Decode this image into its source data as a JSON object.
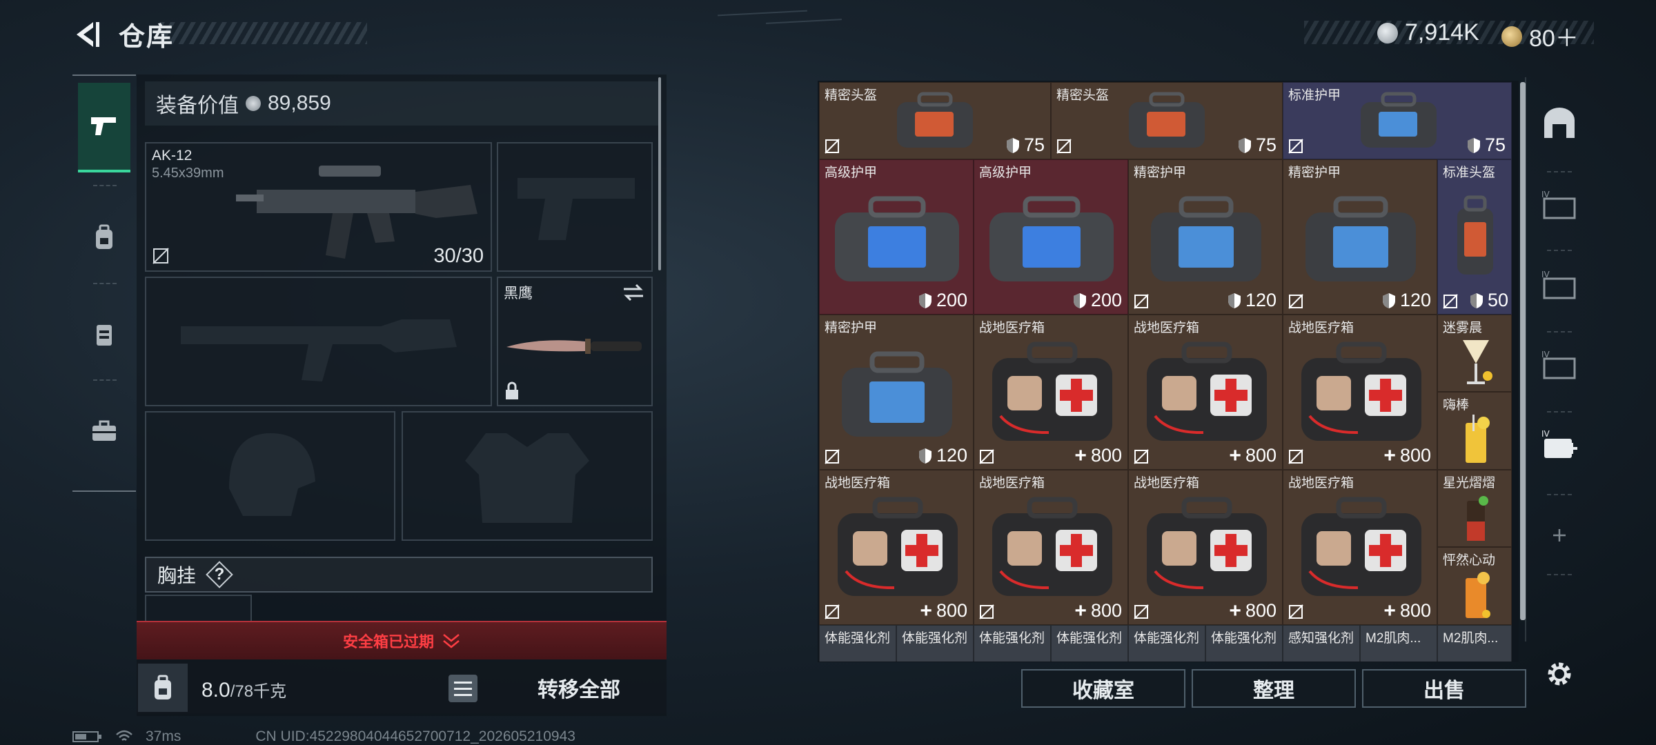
{
  "header": {
    "title": "仓库"
  },
  "currency": {
    "coins": "7,914K",
    "premium": "80＋"
  },
  "equipment": {
    "value_label": "装备价值",
    "value": "89,859",
    "weapon_primary": {
      "name": "AK-12",
      "caliber": "5.45x39mm",
      "ammo": "30/30"
    },
    "knife": {
      "name": "黑鹰"
    },
    "chest_rig": {
      "label": "胸挂",
      "help": "?"
    }
  },
  "safe_box": {
    "status": "安全箱已过期"
  },
  "backpack": {
    "weight": "8.0",
    "capacity": "/78千克"
  },
  "actions": {
    "transfer_all": "转移全部",
    "collection": "收藏室",
    "sort": "整理",
    "sell": "出售"
  },
  "storage": {
    "row1": [
      {
        "name": "精密头盔",
        "value": "75"
      },
      {
        "name": "精密头盔",
        "value": "75"
      },
      {
        "name": "标准护甲",
        "value": "75"
      }
    ],
    "row2": [
      {
        "name": "高级护甲",
        "value": "200"
      },
      {
        "name": "高级护甲",
        "value": "200"
      },
      {
        "name": "精密护甲",
        "value": "120"
      },
      {
        "name": "精密护甲",
        "value": "120"
      },
      {
        "name": "标准头盔",
        "value": "50"
      }
    ],
    "row3": [
      {
        "name": "精密护甲",
        "value": "120"
      },
      {
        "name": "战地医疗箱",
        "value": "800"
      },
      {
        "name": "战地医疗箱",
        "value": "800"
      },
      {
        "name": "战地医疗箱",
        "value": "800"
      }
    ],
    "row4": [
      {
        "name": "战地医疗箱",
        "value": "800"
      },
      {
        "name": "战地医疗箱",
        "value": "800"
      },
      {
        "name": "战地医疗箱",
        "value": "800"
      },
      {
        "name": "战地医疗箱",
        "value": "800"
      }
    ],
    "drinks": [
      "迷雾晨",
      "嗨棒",
      "星光熠熠",
      "怦然心动"
    ],
    "bottom_row": [
      "体能强化剂",
      "体能强化剂",
      "体能强化剂",
      "体能强化剂",
      "体能强化剂",
      "体能强化剂",
      "感知强化剂",
      "M2肌肉...",
      "M2肌肉..."
    ]
  },
  "status_bar": {
    "ping": "37ms",
    "uid": "CN UID:45229804044652700712_202605210943"
  }
}
